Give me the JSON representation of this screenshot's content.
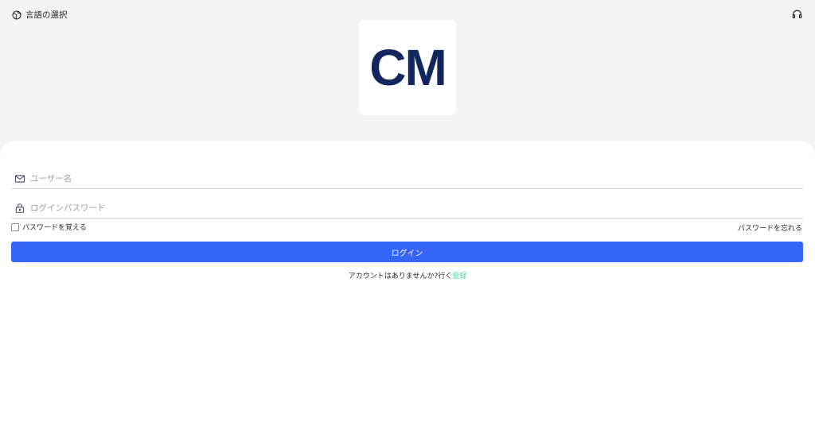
{
  "header": {
    "language_label": "言語の選択",
    "language_icon": "globe-icon",
    "support_icon": "headset-icon"
  },
  "logo": {
    "text": "CM",
    "color": "#13275e"
  },
  "form": {
    "username_placeholder": "ユーザー名",
    "username_value": "",
    "password_placeholder": "ログインパスワード",
    "password_value": "",
    "remember_label": "パスワードを覚える",
    "remember_checked": false,
    "forgot_label": "パスワードを忘れる",
    "login_label": "ログイン",
    "no_account_text": "アカウントはありませんか?行く",
    "register_label": "登録"
  },
  "colors": {
    "accent": "#3565f6",
    "link": "#4cd9a0",
    "background": "#f2f5f6"
  }
}
